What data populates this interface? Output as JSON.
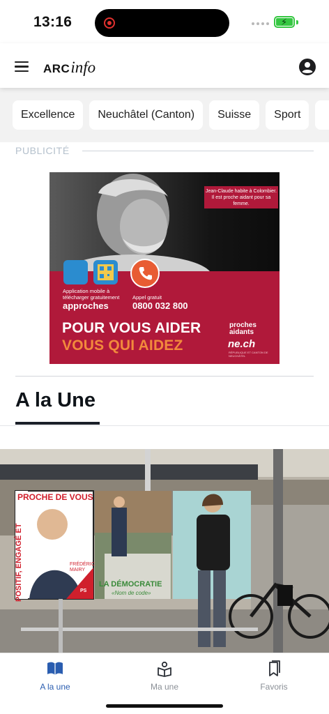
{
  "status": {
    "time": "13:16"
  },
  "header": {
    "logo_main": "ARC",
    "logo_accent": "info"
  },
  "chips": [
    "Excellence",
    "Neuchâtel (Canton)",
    "Suisse",
    "Sport"
  ],
  "ad": {
    "label": "PUBLICITÉ",
    "caption": "Jean-Claude habite à Colombier. Il est proche aidant pour sa femme.",
    "app_text": "Application mobile à télécharger gratuitement",
    "app_name": "approches",
    "call_text": "Appel gratuit",
    "phone": "0800 032 800",
    "slogan_1": "POUR VOUS AIDER",
    "slogan_2": "VOUS QUI AIDEZ",
    "brand_1": "proches aidants",
    "brand_2": "ne.ch",
    "brand_small": "RÉPUBLIQUE ET CANTON DE NEUCHÂTEL"
  },
  "section": {
    "title": "A la Une"
  },
  "article": {
    "poster_headline": "PROCHE DE VOUS",
    "poster_side": "POSITIF, ENGAGÉ ET",
    "poster_name": "FRÉDÉRIC MAIRY",
    "poster_party": "PS",
    "poster_2_text": "LA DÉMOCRATIE",
    "poster_2_sub": "«Nom de code»"
  },
  "tabs": [
    {
      "label": "A la une",
      "active": true
    },
    {
      "label": "Ma une",
      "active": false
    },
    {
      "label": "Favoris",
      "active": false
    }
  ],
  "colors": {
    "accent": "#2a5db0",
    "ad_red": "#b0193a",
    "ad_orange": "#f28a3c"
  }
}
